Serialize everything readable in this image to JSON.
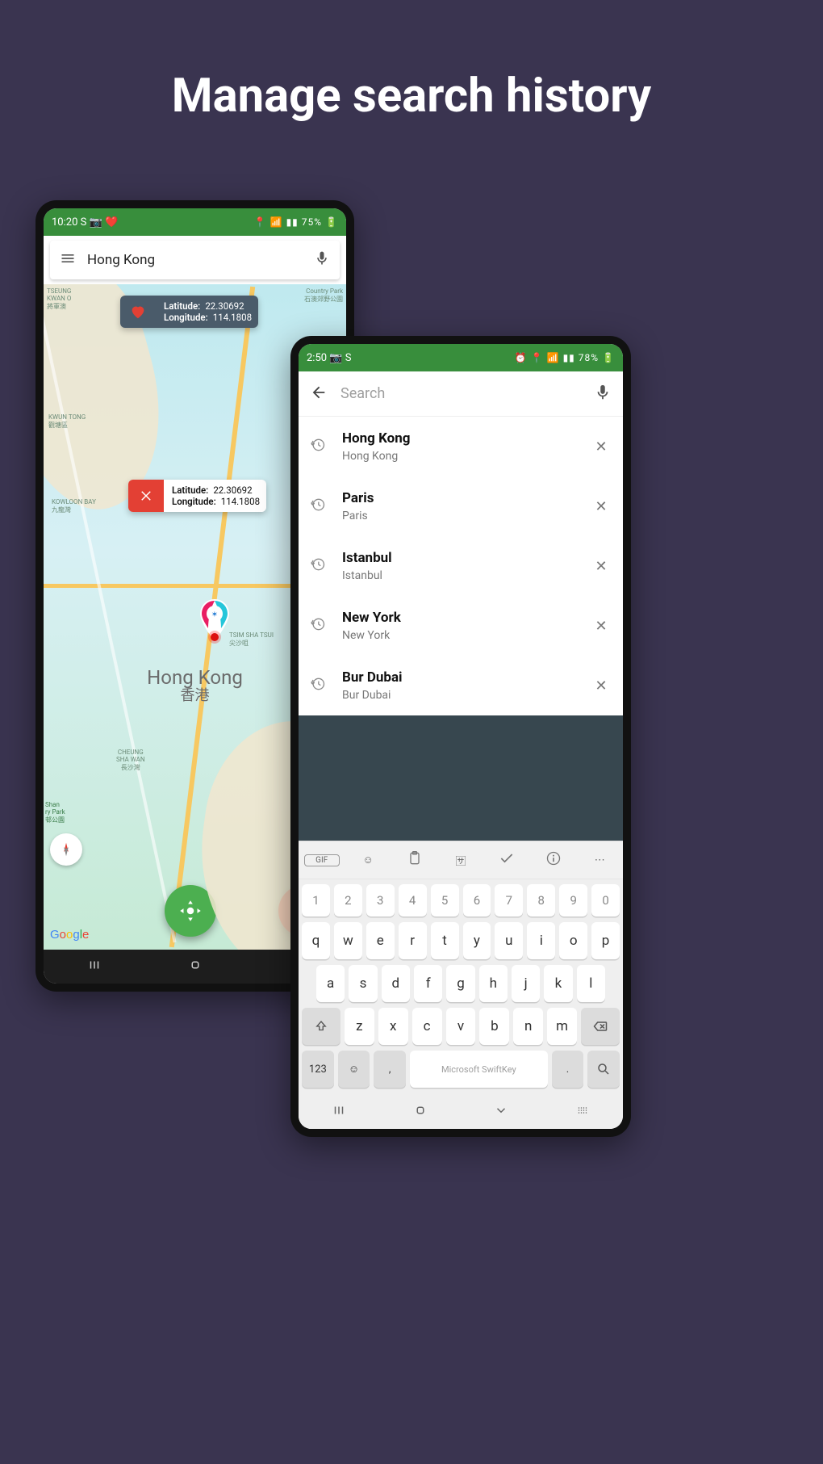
{
  "headline": "Manage search history",
  "phone_left": {
    "status": {
      "time": "10:20",
      "left_extra": "S 📷 ❤️",
      "battery": "75%"
    },
    "search": {
      "value": "Hong Kong"
    },
    "bubble_dark": {
      "lat_label": "Latitude:",
      "lat_value": "22.30692",
      "lng_label": "Longitude:",
      "lng_value": "114.1808"
    },
    "bubble_white": {
      "lat_label": "Latitude:",
      "lat_value": "22.30692",
      "lng_label": "Longitude:",
      "lng_value": "114.1808"
    },
    "city_label": "Hong Kong",
    "city_label_native": "香港",
    "map_tiny_labels": {
      "tseung_kwan": "TSEUNG\nKWAN O\n將軍澳",
      "country_park": "Country Park\n石澳郊野公園",
      "kwun_tong": "KWUN TONG\n觀塘區",
      "kowloon_bay": "KOWLOON BAY\n九龍灣",
      "tsim": "TSIM SHA TSUI\n尖沙咀",
      "cheung": "CHEUNG\nSHA WAN\n長沙灣",
      "shan_park": "Shan\nry Park\n邨公園"
    },
    "tiny_left": "觀塘區"
  },
  "phone_right": {
    "status": {
      "time": "2:50",
      "left_extra": "📷 S",
      "battery": "78%"
    },
    "search_placeholder": "Search",
    "history": [
      {
        "title": "Hong Kong",
        "subtitle": "Hong Kong"
      },
      {
        "title": "Paris",
        "subtitle": "Paris"
      },
      {
        "title": "Istanbul",
        "subtitle": "Istanbul"
      },
      {
        "title": "New York",
        "subtitle": "New York"
      },
      {
        "title": "Bur Dubai",
        "subtitle": "Bur Dubai"
      }
    ],
    "keyboard": {
      "numbers": [
        "1",
        "2",
        "3",
        "4",
        "5",
        "6",
        "7",
        "8",
        "9",
        "0"
      ],
      "row_q": [
        "q",
        "w",
        "e",
        "r",
        "t",
        "y",
        "u",
        "i",
        "o",
        "p"
      ],
      "row_a": [
        "a",
        "s",
        "d",
        "f",
        "g",
        "h",
        "j",
        "k",
        "l"
      ],
      "row_z": [
        "z",
        "x",
        "c",
        "v",
        "b",
        "n",
        "m"
      ],
      "space_label": "Microsoft SwiftKey",
      "sym_label": "123",
      "toolbar": [
        "GIF",
        "sticker-icon",
        "clipboard-icon",
        "translate-icon",
        "check-icon",
        "info-icon",
        "more-icon"
      ]
    }
  }
}
